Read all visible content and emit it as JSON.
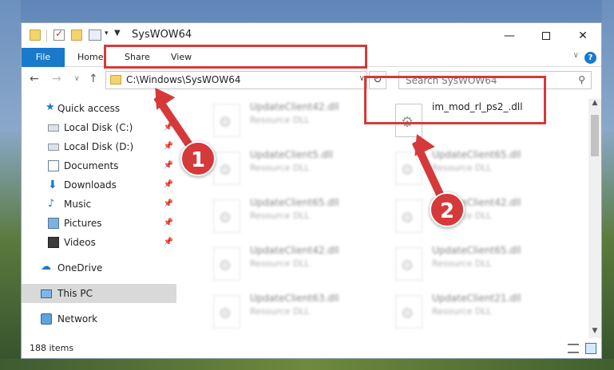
{
  "window": {
    "title": "SysWOW64",
    "minimize": "—",
    "close": "✕"
  },
  "ribbon": {
    "tabs": [
      "File",
      "Home",
      "Share",
      "View"
    ],
    "help": "?",
    "chevron": "∨"
  },
  "address": {
    "path": "C:\\Windows\\SysWOW64",
    "refresh": "↻",
    "search_placeholder": "Search SysWOW64"
  },
  "nav": {
    "back": "←",
    "forward": "→",
    "recent": "∨",
    "up": "↑",
    "items": [
      {
        "label": "Quick access",
        "pinned": false
      },
      {
        "label": "Local Disk (C:)",
        "pinned": true
      },
      {
        "label": "Local Disk (D:)",
        "pinned": true
      },
      {
        "label": "Documents",
        "pinned": true
      },
      {
        "label": "Downloads",
        "pinned": true
      },
      {
        "label": "Music",
        "pinned": true
      },
      {
        "label": "Pictures",
        "pinned": true
      },
      {
        "label": "Videos",
        "pinned": true
      },
      {
        "label": "OneDrive",
        "pinned": false
      },
      {
        "label": "This PC",
        "pinned": false,
        "selected": true
      },
      {
        "label": "Network",
        "pinned": false
      }
    ]
  },
  "files": [
    {
      "name": "UpdateClient42.dll",
      "type": "Resource DLL",
      "blurred": true
    },
    {
      "name": "im_mod_rl_ps2_.dll",
      "type": "",
      "blurred": false
    },
    {
      "name": "UpdateClient5.dll",
      "type": "Resource DLL",
      "blurred": true
    },
    {
      "name": "UpdateClient65.dll",
      "type": "Resource DLL",
      "blurred": true
    },
    {
      "name": "UpdateClient65.dll",
      "type": "Resource DLL",
      "blurred": true
    },
    {
      "name": "UpdateClient42.dll",
      "type": "Resource DLL",
      "blurred": true
    },
    {
      "name": "UpdateClient42.dll",
      "type": "Resource DLL",
      "blurred": true
    },
    {
      "name": "UpdateClient65.dll",
      "type": "Resource DLL",
      "blurred": true
    },
    {
      "name": "UpdateClient63.dll",
      "type": "Resource DLL",
      "blurred": true
    },
    {
      "name": "UpdateClient21.dll",
      "type": "Resource DLL",
      "blurred": true
    }
  ],
  "status": {
    "item_count": "188 items"
  },
  "callouts": [
    "1",
    "2"
  ],
  "colors": {
    "accent": "#1979ca",
    "highlight": "#d6393a"
  }
}
